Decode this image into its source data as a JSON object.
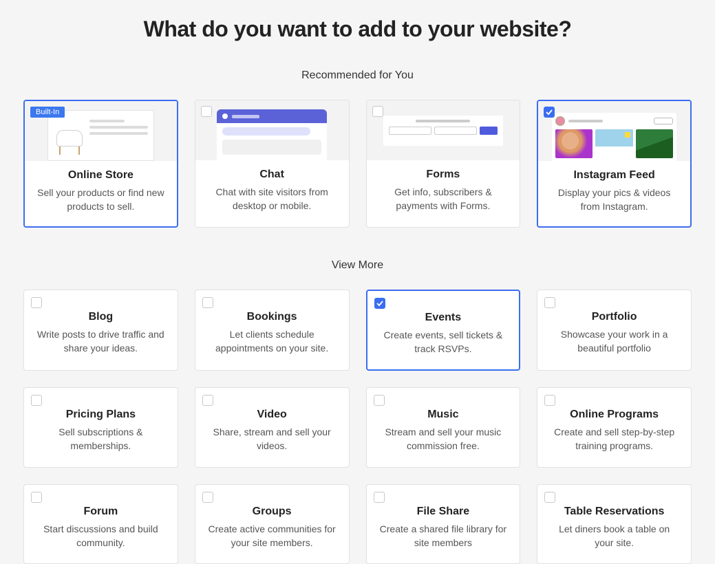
{
  "title": "What do you want to add to your website?",
  "sections": {
    "recommended_label": "Recommended for You",
    "view_more_label": "View More"
  },
  "badges": {
    "built_in": "Built-In"
  },
  "recommended": [
    {
      "id": "online-store",
      "title": "Online Store",
      "desc": "Sell your products or find new products to sell.",
      "builtin": true,
      "checked": false,
      "selected": true
    },
    {
      "id": "chat",
      "title": "Chat",
      "desc": "Chat with site visitors from desktop or mobile.",
      "builtin": false,
      "checked": false,
      "selected": false
    },
    {
      "id": "forms",
      "title": "Forms",
      "desc": "Get info, subscribers & payments with Forms.",
      "builtin": false,
      "checked": false,
      "selected": false
    },
    {
      "id": "instagram-feed",
      "title": "Instagram Feed",
      "desc": "Display your pics & videos from Instagram.",
      "builtin": false,
      "checked": true,
      "selected": true
    }
  ],
  "more": [
    {
      "id": "blog",
      "title": "Blog",
      "desc": "Write posts to drive traffic and share your ideas.",
      "checked": false,
      "selected": false
    },
    {
      "id": "bookings",
      "title": "Bookings",
      "desc": "Let clients schedule appointments on your site.",
      "checked": false,
      "selected": false
    },
    {
      "id": "events",
      "title": "Events",
      "desc": "Create events, sell tickets & track RSVPs.",
      "checked": true,
      "selected": true
    },
    {
      "id": "portfolio",
      "title": "Portfolio",
      "desc": "Showcase your work in a beautiful portfolio",
      "checked": false,
      "selected": false
    },
    {
      "id": "pricing-plans",
      "title": "Pricing Plans",
      "desc": "Sell subscriptions & memberships.",
      "checked": false,
      "selected": false
    },
    {
      "id": "video",
      "title": "Video",
      "desc": "Share, stream and sell your videos.",
      "checked": false,
      "selected": false
    },
    {
      "id": "music",
      "title": "Music",
      "desc": "Stream and sell your music commission free.",
      "checked": false,
      "selected": false
    },
    {
      "id": "online-programs",
      "title": "Online Programs",
      "desc": "Create and sell step-by-step training programs.",
      "checked": false,
      "selected": false
    },
    {
      "id": "forum",
      "title": "Forum",
      "desc": "Start discussions and build community.",
      "checked": false,
      "selected": false
    },
    {
      "id": "groups",
      "title": "Groups",
      "desc": "Create active communities for your site members.",
      "checked": false,
      "selected": false
    },
    {
      "id": "file-share",
      "title": "File Share",
      "desc": "Create a shared file library for site members",
      "checked": false,
      "selected": false
    },
    {
      "id": "table-reservations",
      "title": "Table Reservations",
      "desc": "Let diners book a table on your site.",
      "checked": false,
      "selected": false
    }
  ]
}
